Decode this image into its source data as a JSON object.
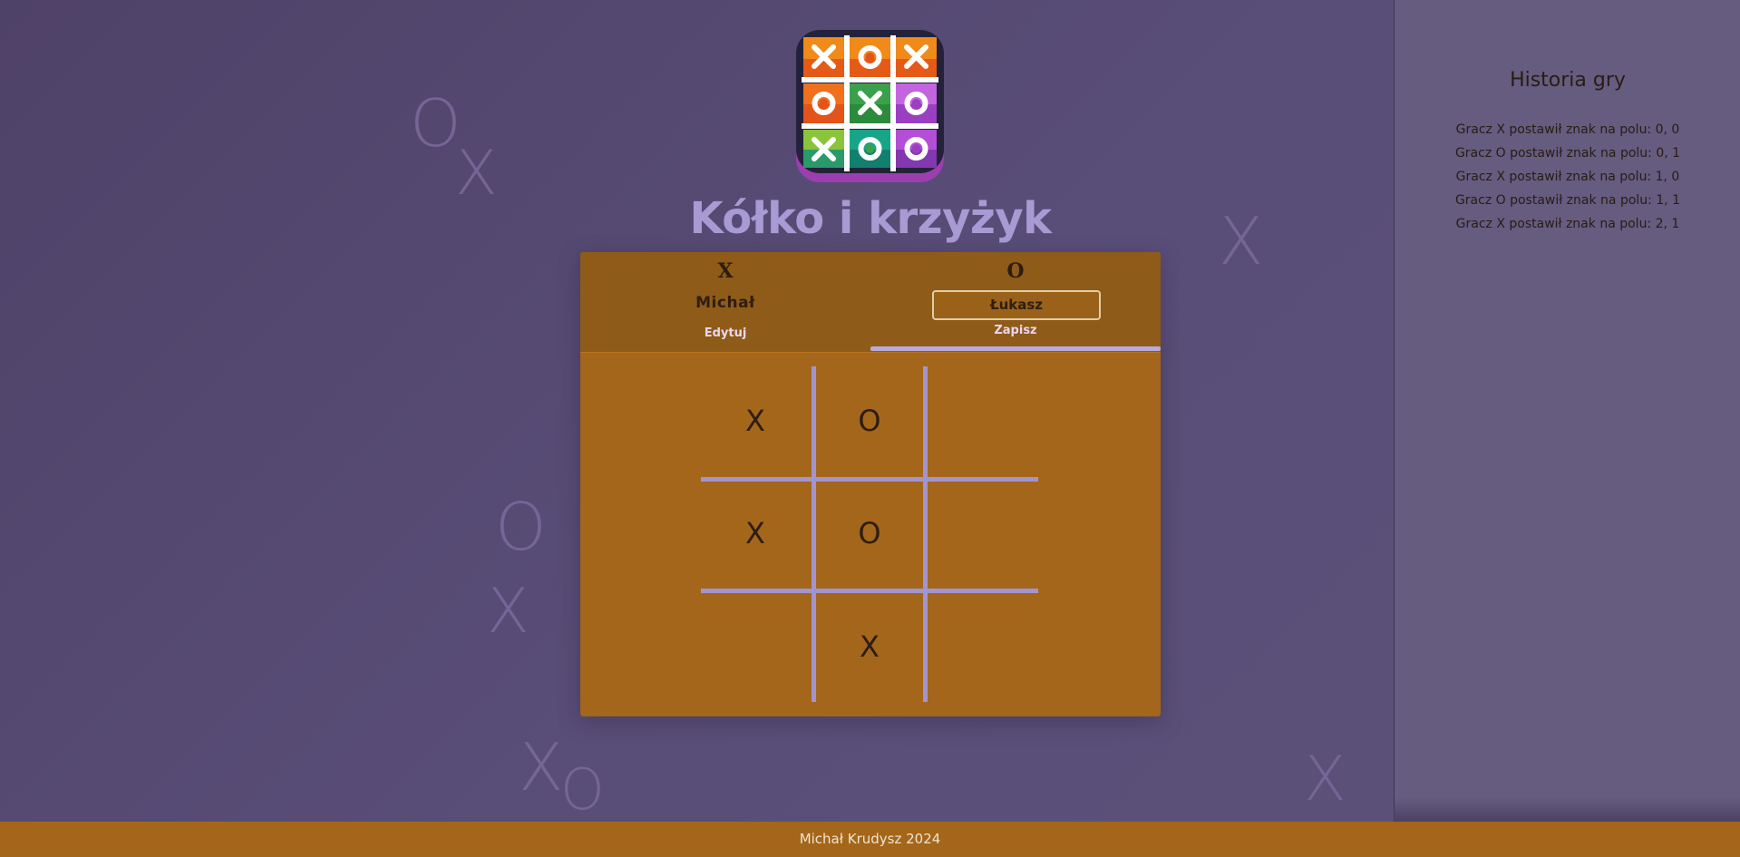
{
  "app": {
    "title": "Kółko i krzyżyk"
  },
  "colors": {
    "background": "#564a72",
    "sidebar": "#655c80",
    "accent": "#a4661a",
    "title": "#a89bd3",
    "grid": "#a295cf"
  },
  "decorations": [
    "O",
    "X",
    "X",
    "O",
    "X",
    "X",
    "O",
    "X"
  ],
  "players": [
    {
      "symbol": "X",
      "name": "Michał",
      "action": "Edytuj",
      "editing": false,
      "active": false
    },
    {
      "symbol": "O",
      "name": "Łukasz",
      "action": "Zapisz",
      "editing": true,
      "active": true
    }
  ],
  "board": {
    "cells": [
      [
        "X",
        "O",
        ""
      ],
      [
        "X",
        "O",
        ""
      ],
      [
        "",
        "X",
        ""
      ]
    ]
  },
  "history": {
    "title": "Historia gry",
    "entries": [
      "Gracz X postawił znak na polu: 0, 0",
      "Gracz O postawił znak na polu: 0, 1",
      "Gracz X postawił znak na polu: 1, 0",
      "Gracz O postawił znak na polu: 1, 1",
      "Gracz X postawił znak na polu: 2, 1"
    ]
  },
  "footer": {
    "text": "Michał Krudysz 2024"
  }
}
